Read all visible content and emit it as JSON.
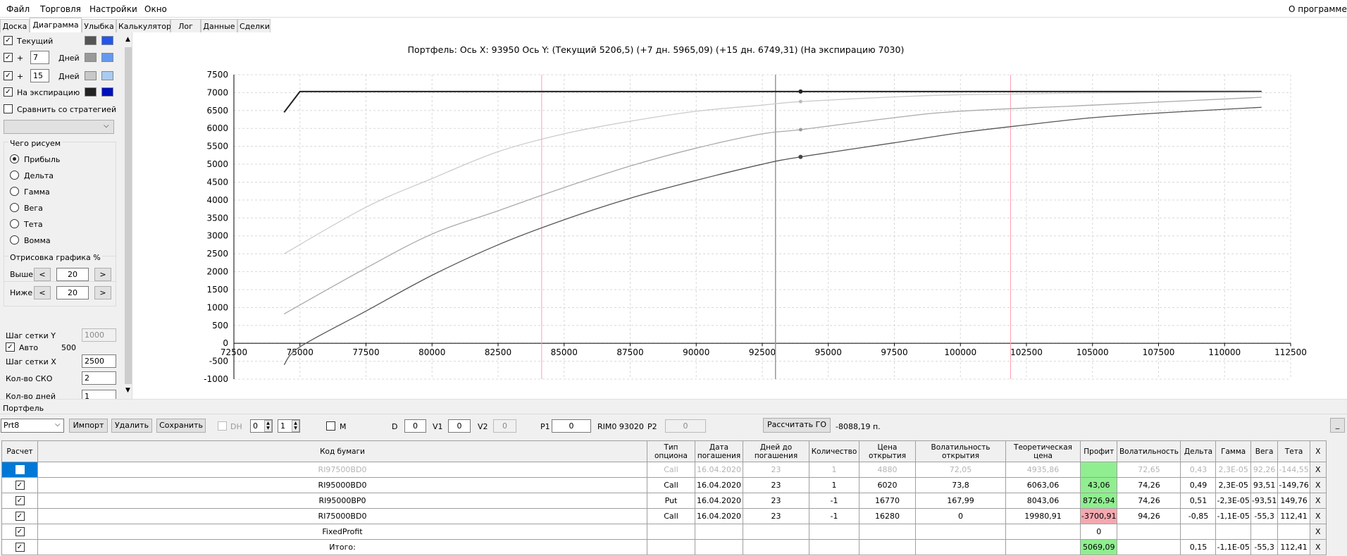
{
  "menu": {
    "file": "Файл",
    "trade": "Торговля",
    "settings": "Настройки",
    "window": "Окно",
    "about": "О программе"
  },
  "tabs": [
    "Доска",
    "Диаграмма",
    "Улыбка",
    "Калькулятор",
    "Лог",
    "Данные",
    "Сделки"
  ],
  "left": {
    "current_label": "Текущий",
    "plus": "+",
    "days1": "7",
    "days2": "15",
    "days_label": "Дней",
    "expiry_label": "На экспирацию",
    "compare_label": "Сравнить со стратегией",
    "what_group": "Чего рисуем",
    "radios": [
      "Прибыль",
      "Дельта",
      "Гамма",
      "Вега",
      "Тета",
      "Вомма"
    ],
    "render_group": "Отрисовка графика %",
    "above_label": "Выше",
    "below_label": "Ниже",
    "above_value": "20",
    "below_value": "20",
    "btn_left": "<",
    "btn_right": ">",
    "grid_y_label": "Шаг сетки Y",
    "grid_y_value": "1000",
    "auto_label": "Авто",
    "auto_value": "500",
    "grid_x_label": "Шаг сетки X",
    "grid_x_value": "2500",
    "sko_label": "Кол-во СКО",
    "sko_value": "2",
    "days_count_label": "Кол-во дней",
    "days_count_value": "1"
  },
  "colors": {
    "swatch_current_dark": "#555555",
    "swatch_current_blue": "#2255ee",
    "swatch_7_dark": "#999999",
    "swatch_7_blue": "#6699ee",
    "swatch_15_dark": "#c8c8c8",
    "swatch_15_blue": "#aaccf0",
    "swatch_exp_dark": "#222222",
    "swatch_exp_blue": "#0011bb",
    "curve_expiry": "#222222",
    "curve_current": "#555555",
    "curve_7": "#aaaaaa",
    "curve_15": "#cccccc",
    "sko_line": "#ff9eb0",
    "cursor_line": "#999999"
  },
  "chart_data": {
    "type": "line",
    "title": "Портфель: Ось X: 93950 Ось Y:  (Текущий 5206,5)  (+7 дн. 5965,09)  (+15 дн. 6749,31)  (На экспирацию 7030)",
    "xlim": [
      72500,
      112500
    ],
    "ylim": [
      -1000,
      7500
    ],
    "xticks": [
      "72500",
      "75000",
      "77500",
      "80000",
      "82500",
      "85000",
      "87500",
      "90000",
      "92500",
      "95000",
      "97500",
      "100000",
      "102500",
      "105000",
      "107500",
      "110000",
      "112500"
    ],
    "yticks": [
      "7500",
      "7000",
      "6500",
      "6000",
      "5500",
      "5000",
      "4500",
      "4000",
      "3500",
      "3000",
      "2500",
      "2000",
      "1500",
      "1000",
      "500",
      "0",
      "-500",
      "-1000"
    ],
    "grid": true,
    "vlines": {
      "sko_low": 84150,
      "sko_high": 101900,
      "cursor": 93000
    },
    "series": [
      {
        "name": "На экспирацию",
        "color": "#222222",
        "points": [
          [
            74400,
            6450
          ],
          [
            75000,
            7030
          ],
          [
            111400,
            7030
          ]
        ]
      },
      {
        "name": "+15 дн.",
        "color": "#cccccc",
        "points": [
          [
            74400,
            2500
          ],
          [
            77500,
            3800
          ],
          [
            80000,
            4600
          ],
          [
            82500,
            5350
          ],
          [
            85000,
            5850
          ],
          [
            87500,
            6200
          ],
          [
            90000,
            6480
          ],
          [
            92500,
            6650
          ],
          [
            93950,
            6749
          ],
          [
            97500,
            6880
          ],
          [
            100000,
            6940
          ],
          [
            105000,
            6990
          ],
          [
            111400,
            7010
          ]
        ]
      },
      {
        "name": "+7 дн.",
        "color": "#aaaaaa",
        "points": [
          [
            74400,
            820
          ],
          [
            77500,
            2100
          ],
          [
            80000,
            3050
          ],
          [
            82500,
            3700
          ],
          [
            85000,
            4350
          ],
          [
            87500,
            4950
          ],
          [
            90000,
            5450
          ],
          [
            92500,
            5850
          ],
          [
            93950,
            5965
          ],
          [
            97500,
            6300
          ],
          [
            100000,
            6480
          ],
          [
            105000,
            6650
          ],
          [
            111400,
            6870
          ]
        ]
      },
      {
        "name": "Текущий",
        "color": "#555555",
        "points": [
          [
            74400,
            -600
          ],
          [
            75000,
            -100
          ],
          [
            77500,
            900
          ],
          [
            80000,
            1900
          ],
          [
            82500,
            2750
          ],
          [
            85000,
            3450
          ],
          [
            87500,
            4050
          ],
          [
            90000,
            4550
          ],
          [
            92500,
            5000
          ],
          [
            93950,
            5206
          ],
          [
            97500,
            5600
          ],
          [
            100000,
            5880
          ],
          [
            102500,
            6100
          ],
          [
            105000,
            6300
          ],
          [
            107500,
            6430
          ],
          [
            111400,
            6590
          ]
        ]
      }
    ],
    "markers": [
      [
        93950,
        7030
      ],
      [
        93950,
        6749
      ],
      [
        93950,
        5965
      ],
      [
        93950,
        5206
      ]
    ]
  },
  "portfolio": {
    "section_label": "Портфель",
    "name": "Prt8",
    "import": "Импорт",
    "delete": "Удалить",
    "save": "Сохранить",
    "dh_label": "DH",
    "spin1": "0",
    "spin2": "1",
    "m_label": "M",
    "d_label": "D",
    "d_value": "0",
    "v1_label": "V1",
    "v1_value": "0",
    "v2_label": "V2",
    "v2_value": "0",
    "p1_label": "P1",
    "p1_value": "0",
    "instrument": "RIM0 93020",
    "p2_label": "P2",
    "p2_value": "0",
    "calc_go": "Рассчитать ГО",
    "go_value": "-8088,19 п.",
    "minimize": "_"
  },
  "table": {
    "headers": [
      "Расчет",
      "Код бумаги",
      "Тип опциона",
      "Дата погашения",
      "Дней до погашения",
      "Количество",
      "Цена открытия",
      "Волатильность открытия",
      "Теоретическая цена",
      "Профит",
      "Волатильность",
      "Дельта",
      "Гамма",
      "Вега",
      "Тета",
      "X"
    ],
    "rows": [
      {
        "code": "RI97500BD0",
        "type": "Call",
        "date": "16.04.2020",
        "days": "23",
        "qty": "1",
        "open": "4880",
        "vol_open": "72,05",
        "theor": "4935,86",
        "profit": "",
        "vol": "72,65",
        "delta": "0,43",
        "gamma": "2,3E-05",
        "vega": "92,26",
        "theta": "-144,55",
        "x": "X"
      },
      {
        "code": "RI95000BD0",
        "type": "Call",
        "date": "16.04.2020",
        "days": "23",
        "qty": "1",
        "open": "6020",
        "vol_open": "73,8",
        "theor": "6063,06",
        "profit": "43,06",
        "vol": "74,26",
        "delta": "0,49",
        "gamma": "2,3E-05",
        "vega": "93,51",
        "theta": "-149,76",
        "x": "X"
      },
      {
        "code": "RI95000BP0",
        "type": "Put",
        "date": "16.04.2020",
        "days": "23",
        "qty": "-1",
        "open": "16770",
        "vol_open": "167,99",
        "theor": "8043,06",
        "profit": "8726,94",
        "vol": "74,26",
        "delta": "0,51",
        "gamma": "-2,3E-05",
        "vega": "-93,51",
        "theta": "149,76",
        "x": "X"
      },
      {
        "code": "RI75000BD0",
        "type": "Call",
        "date": "16.04.2020",
        "days": "23",
        "qty": "-1",
        "open": "16280",
        "vol_open": "0",
        "theor": "19980,91",
        "profit": "-3700,91",
        "vol": "94,26",
        "delta": "-0,85",
        "gamma": "-1,1E-05",
        "vega": "-55,3",
        "theta": "112,41",
        "x": "X"
      }
    ],
    "fixed": {
      "code": "FixedProfit",
      "profit": "0",
      "x": "X"
    },
    "total": {
      "code": "Итого:",
      "profit": "5069,09",
      "delta": "0,15",
      "gamma": "-1,1E-05",
      "vega": "-55,3",
      "theta": "112,41",
      "x": "X"
    }
  }
}
